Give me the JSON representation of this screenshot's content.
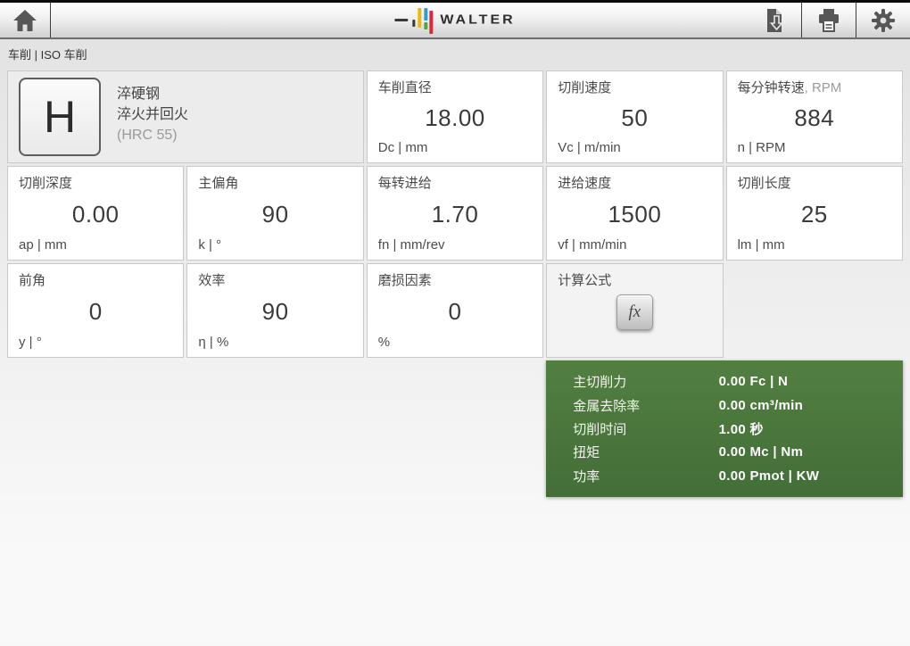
{
  "topbar": {
    "logo_text": "WALTER",
    "icon_names": [
      "home-icon",
      "export-document-icon",
      "print-icon",
      "settings-gear-icon"
    ]
  },
  "breadcrumb": "车削 | ISO 车削",
  "material": {
    "code": "H",
    "line1": "淬硬钢",
    "line2": "淬火并回火",
    "line3": "(HRC 55)"
  },
  "cards": [
    {
      "title": "车削直径",
      "value": "18.00",
      "unit": "Dc | mm"
    },
    {
      "title": "切削速度",
      "value": "50",
      "unit": "Vc | m/min"
    },
    {
      "title": "每分钟转速",
      "title_suffix": ", RPM",
      "value": "884",
      "unit": "n | RPM"
    },
    {
      "title": "切削深度",
      "value": "0.00",
      "unit": "ap | mm"
    },
    {
      "title": "主偏角",
      "value": "90",
      "unit": "k | °"
    },
    {
      "title": "每转进给",
      "value": "1.70",
      "unit": "fn | mm/rev"
    },
    {
      "title": "进给速度",
      "value": "1500",
      "unit": "vf | mm/min"
    },
    {
      "title": "切削长度",
      "value": "25",
      "unit": "lm | mm"
    },
    {
      "title": "前角",
      "value": "0",
      "unit": "y | °"
    },
    {
      "title": "效率",
      "value": "90",
      "unit": "η | %"
    },
    {
      "title": "磨损因素",
      "value": "0",
      "unit": "%"
    }
  ],
  "formula_card": {
    "title": "计算公式",
    "button_label": "fx"
  },
  "results": {
    "rows": [
      {
        "label": "主切削力",
        "value": "0.00 Fc | N"
      },
      {
        "label": "金属去除率",
        "value": "0.00 cm³/min"
      },
      {
        "label": "切削时间",
        "value": "1.00 秒"
      },
      {
        "label": "扭矩",
        "value": "0.00 Mc | Nm"
      },
      {
        "label": "功率",
        "value": "0.00 Pmot | KW"
      }
    ]
  },
  "colors": {
    "results_green": "#4c7a3c",
    "logo_yellow": "#eab80e",
    "logo_blue": "#2f9fd3",
    "logo_red": "#d62b3a",
    "logo_green": "#4fa83d"
  }
}
